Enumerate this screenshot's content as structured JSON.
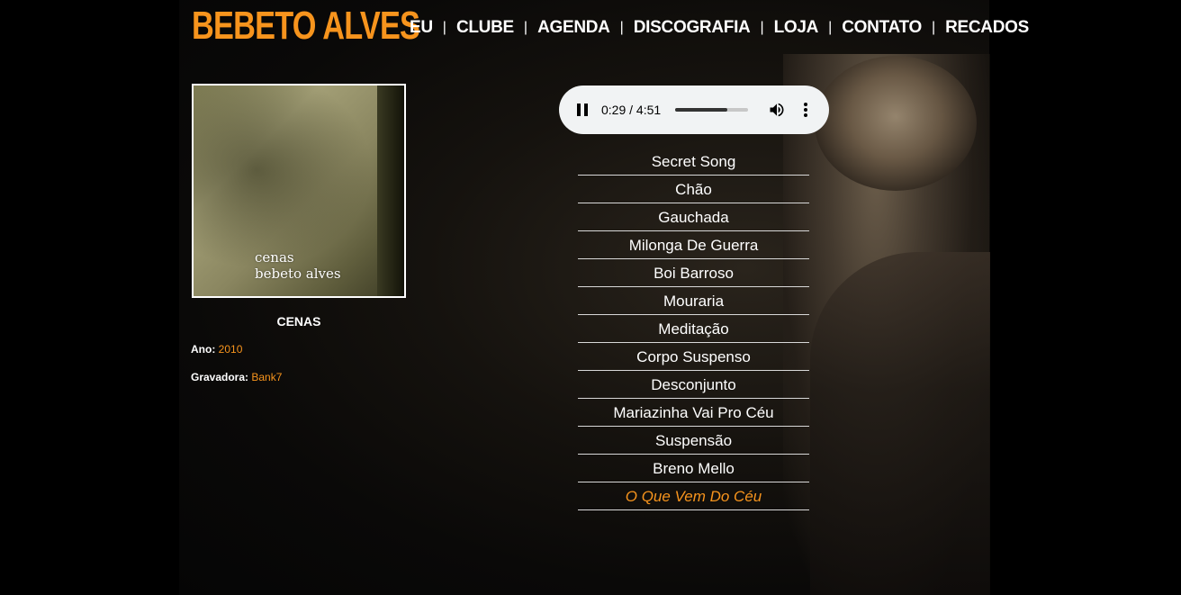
{
  "logo": "BEBETO ALVES",
  "nav": {
    "items": [
      "EU",
      "CLUBE",
      "AGENDA",
      "DISCOGRAFIA",
      "LOJA",
      "CONTATO",
      "RECADOS"
    ],
    "separator": "|"
  },
  "album": {
    "cover_text_line1": "cenas",
    "cover_text_line2": "bebeto alves",
    "title": "CENAS",
    "year_label": "Ano:",
    "year_value": "2010",
    "label_label": "Gravadora:",
    "label_value": "Bank7"
  },
  "player": {
    "time": "0:29 / 4:51",
    "progress_fraction": 0.72,
    "icons": [
      "pause-icon",
      "volume-icon",
      "more-vert-icon"
    ]
  },
  "tracks": [
    "Secret Song",
    "Chão",
    "Gauchada",
    "Milonga De Guerra",
    "Boi Barroso",
    "Mouraria",
    "Meditação",
    "Corpo Suspenso",
    "Desconjunto",
    "Mariazinha Vai Pro Céu",
    "Suspensão",
    "Breno Mello",
    "O Que Vem Do Céu"
  ],
  "active_track_index": 12,
  "colors": {
    "accent": "#f7941d",
    "background": "#000000",
    "text": "#ffffff"
  }
}
